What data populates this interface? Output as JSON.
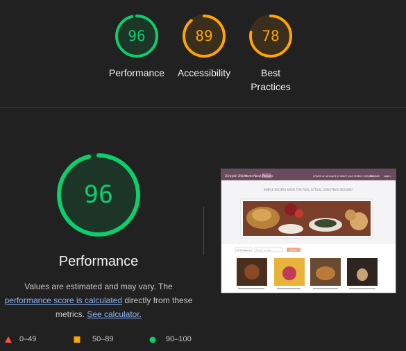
{
  "summary": {
    "categories": [
      {
        "label": "Performance",
        "score": 96,
        "color": "#0cce6b",
        "bg": "#1e3a2a",
        "track": "#1e3a2a"
      },
      {
        "label": "Accessibility",
        "score": 89,
        "color": "#ffa400",
        "bg": "#3a2f1c",
        "track": "#3a2f1c"
      },
      {
        "label": "Best Practices",
        "score": 78,
        "color": "#ffa400",
        "bg": "#3a2f1c",
        "track": "#3a2f1c"
      }
    ]
  },
  "detail": {
    "title": "Performance",
    "score": 96,
    "color": "#0cce6b",
    "desc_prefix": "Values are estimated and may vary. The",
    "link1": "performance score is calculated",
    "desc_mid": " directly from these metrics. ",
    "link2": "See calculator."
  },
  "screenshot": {
    "brand": "Simple Bites",
    "nav": [
      "Home",
      "About",
      "Recipes"
    ],
    "tagline": "Create an account to share your festive recipes!",
    "auth": [
      "Register",
      "Login"
    ],
    "heading": "SIMPLE RECIPES MADE FOR REAL ACTUAL CHRISTMAS SEASON?",
    "filter": "All Categories",
    "search_placeholder": "Search recipes...",
    "search_btn": "Search"
  },
  "legend": {
    "fail": "0–49",
    "average": "50–89",
    "pass": "90–100",
    "fail_color": "#ff4e42",
    "average_color": "#ffa400",
    "pass_color": "#0cce6b"
  }
}
